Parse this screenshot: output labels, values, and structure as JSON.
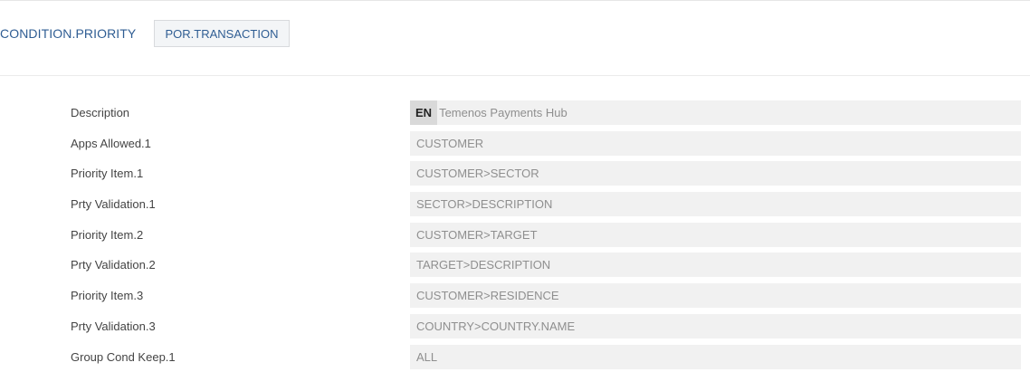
{
  "header": {
    "application": "CONDITION.PRIORITY",
    "record_id": "POR.TRANSACTION"
  },
  "form": {
    "fields": [
      {
        "label": "Description",
        "lang": "EN",
        "value": "Temenos Payments Hub"
      },
      {
        "label": "Apps Allowed.1",
        "value": "CUSTOMER"
      },
      {
        "label": "Priority Item.1",
        "value": "CUSTOMER>SECTOR"
      },
      {
        "label": "Prty Validation.1",
        "value": "SECTOR>DESCRIPTION"
      },
      {
        "label": "Priority Item.2",
        "value": "CUSTOMER>TARGET"
      },
      {
        "label": "Prty Validation.2",
        "value": "TARGET>DESCRIPTION"
      },
      {
        "label": "Priority Item.3",
        "value": "CUSTOMER>RESIDENCE"
      },
      {
        "label": "Prty Validation.3",
        "value": "COUNTRY>COUNTRY.NAME"
      },
      {
        "label": "Group Cond Keep.1",
        "value": "ALL"
      }
    ]
  },
  "colors": {
    "accent": "#2f5d93",
    "field_bg": "#f1f1f1",
    "label_text": "#444444"
  }
}
